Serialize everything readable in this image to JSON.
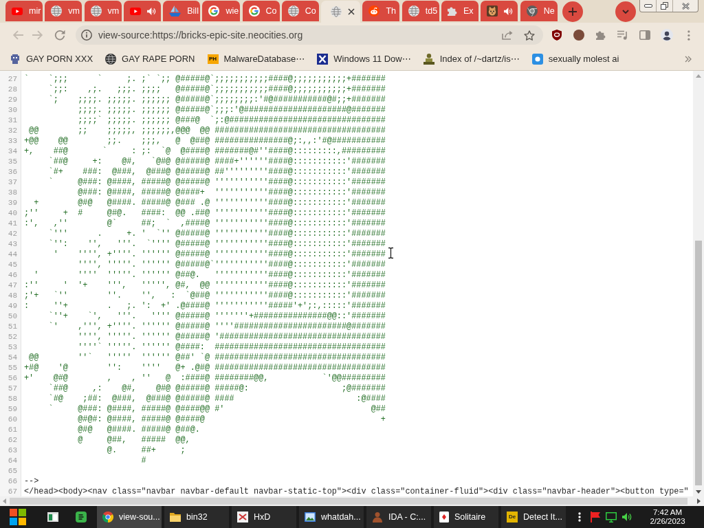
{
  "tabs": [
    {
      "kind": "play",
      "title": "mir",
      "audio": false,
      "selected": false
    },
    {
      "kind": "globe",
      "title": "vm",
      "audio": false,
      "selected": false
    },
    {
      "kind": "globe",
      "title": "vm",
      "audio": false,
      "selected": false
    },
    {
      "kind": "play",
      "audio": true,
      "selected": false
    },
    {
      "kind": "boat",
      "title": "Bill",
      "audio": false,
      "selected": false
    },
    {
      "kind": "gletter",
      "title": "wie",
      "audio": false,
      "selected": false
    },
    {
      "kind": "gletter",
      "title": "Co",
      "audio": false,
      "selected": false
    },
    {
      "kind": "globe",
      "title": "Co",
      "audio": false,
      "selected": false
    },
    {
      "kind": "globe",
      "audio": false,
      "selected": true
    },
    {
      "kind": "alien",
      "title": "Th",
      "audio": false,
      "selected": false
    },
    {
      "kind": "globe",
      "title": "td5",
      "audio": false,
      "selected": false
    },
    {
      "kind": "puzzle",
      "title": "Ex",
      "audio": false,
      "selected": false
    },
    {
      "kind": "animal",
      "audio": true,
      "selected": false
    },
    {
      "kind": "aperture",
      "title": "Ne",
      "audio": false,
      "selected": false
    }
  ],
  "toolbar": {
    "back": {
      "disabled": true
    },
    "forward": {
      "disabled": true
    },
    "address": "view-source:https://bricks-epic-site.neocities.org"
  },
  "bookmarks": [
    {
      "kind": "pixel",
      "title": "GAY PORN XXX"
    },
    {
      "kind": "globe",
      "title": "GAY RAPE PORN"
    },
    {
      "kind": "letters",
      "logo": "PH",
      "title": "MalwareDatabase⋯"
    },
    {
      "kind": "cross",
      "title": "Windows 11 Dow⋯"
    },
    {
      "kind": "person",
      "title": "Index of /~dartz/is⋯"
    },
    {
      "kind": "tile",
      "title": "sexually molest ai"
    }
  ],
  "source": {
    "lines": [
      {
        "number": "27",
        "kind": "comment",
        "text": "`    `;;;      `     ;. ;` `;; @#####@`;;;;;;;;;;;####@;;;;;;;;;;;+#######"
      },
      {
        "number": "28",
        "kind": "comment",
        "text": "     `;;:    ,;.   ;;;. ;;;;   @#####@`;;;;;;;;;;;####@;;;;;;;;;;;+#######"
      },
      {
        "number": "29",
        "kind": "comment",
        "text": "     `;    ;;;;. ;;;;;. ;;;;;; @#####@`;;;;;;;;:'#@###########@#;;+#######"
      },
      {
        "number": "30",
        "kind": "comment",
        "text": "           ;;;;. ;;;;;. ;;;;;; @#####@`;;;:'@#####################@#######"
      },
      {
        "number": "31",
        "kind": "comment",
        "text": "           ;;;;` ;;;;;. ;;;;;; @###@  `;:@################################"
      },
      {
        "number": "32",
        "kind": "comment",
        "text": " @@        ;;    ;;;;;, ;;;;;;,@@@  @@ ###################################"
      },
      {
        "number": "33",
        "kind": "comment",
        "text": "+@@    @@        ;;.    ;;;,   @  @##@ ###############@;:,,:'#@###########"
      },
      {
        "number": "34",
        "kind": "comment",
        "text": "+,    ##@       `     : ;:  `@  @####@ #######@#''####@:::::::::,#########"
      },
      {
        "number": "35",
        "kind": "comment",
        "text": "     `##@     +:    @#,   `@#@ @#####@ ####+''''''####@:::::::::::'#######"
      },
      {
        "number": "36",
        "kind": "comment",
        "text": "     `#+    ###:  @###,  @###@ @#####@ ##'''''''''####@:::::::::::'#######"
      },
      {
        "number": "37",
        "kind": "comment",
        "text": "     `     @###: @####, #####@ @#####@ '''''''''''####@:::::::::::'#######"
      },
      {
        "number": "38",
        "kind": "comment",
        "text": "           @###: @####, #####@ @####+  '''''''''''####@:::::::::::'#######"
      },
      {
        "number": "39",
        "kind": "comment",
        "text": "  +        @#@   @####. #####@ @### .@ '''''''''''####@:::::::::::'#######"
      },
      {
        "number": "40",
        "kind": "comment",
        "text": ";''     +  #     @#@.   ####:  @@ .##@ '''''''''''####@:::::::::::'#######"
      },
      {
        "number": "41",
        "kind": "comment",
        "text": ":',   ,''        @`     ##;  `  ,####@ '''''''''''####@:::::::::::'#######"
      },
      {
        "number": "42",
        "kind": "comment",
        "text": "     `'''      .     +. '  `'' @#####@ '''''''''''####@:::::::::::'#######"
      },
      {
        "number": "43",
        "kind": "comment",
        "text": "     `'':    '',   '''.  `'''' @#####@ '''''''''''####@:::::::::::'#######"
      },
      {
        "number": "44",
        "kind": "comment",
        "text": "      '    '''', +''''. '''''' @#####@ '''''''''''####@:::::::::::'#######"
      },
      {
        "number": "45",
        "kind": "comment",
        "text": "           '''', '''''. '''''' @#####@`'''''''''''####@:::::::::::'#######"
      },
      {
        "number": "46",
        "kind": "comment",
        "text": "  '        ''''  '''''. '''''' @##@.   '''''''''''####@:::::::::::'#######"
      },
      {
        "number": "47",
        "kind": "comment",
        "text": ":''     '  '+    ''',   ''''', @#,  @@ '''''''''''####@:::::::::::'#######"
      },
      {
        "number": "48",
        "kind": "comment",
        "text": ";'+   `''        ''.    '',   :  `@##@ '''''''''''####@:::::::::::'#######"
      },
      {
        "number": "49",
        "kind": "comment",
        "text": ":     ''+        .   ;. ':  +' .@####@ '''''''''''#####'+';:,:::::'#######"
      },
      {
        "number": "50",
        "kind": "comment",
        "text": "     `''+    `',   '''.   '''' @#####@ '''''''+###############@@::'#######"
      },
      {
        "number": "51",
        "kind": "comment",
        "text": "     `'    ,''', +''''. '''''' @#####@ ''''#######################@#######"
      },
      {
        "number": "52",
        "kind": "comment",
        "text": "           '''', '''''. '''''' @#####@ '##################################"
      },
      {
        "number": "53",
        "kind": "comment",
        "text": "           ''''` '''''. '''''' @####:  ###################################"
      },
      {
        "number": "54",
        "kind": "comment",
        "text": " @@        ''`   '''''  '''''' @##' `@ ###################################"
      },
      {
        "number": "55",
        "kind": "comment",
        "text": "+#@    '@        '':    ''''   @+ .@#@ ###################################"
      },
      {
        "number": "56",
        "kind": "comment",
        "text": "+'    @#@        ,    , ''   @  :####@ ########@@,           `'@@#########"
      },
      {
        "number": "57",
        "kind": "comment",
        "text": "     `##@     ,:    @#,    @#@ @#####@ #####@:                   ;@#######"
      },
      {
        "number": "58",
        "kind": "comment",
        "text": "     `#@    ;##:  @###,  @###@ @#####@ ####                         :@####"
      },
      {
        "number": "59",
        "kind": "comment",
        "text": "     `     @###: @####, #####@ @####@@ #'                              @##"
      },
      {
        "number": "60",
        "kind": "comment",
        "text": "           @#@#: @####, #####@ @####@                                    +"
      },
      {
        "number": "61",
        "kind": "comment",
        "text": "           @#@   @####. #####@ @##@."
      },
      {
        "number": "62",
        "kind": "comment",
        "text": "           @     @##,   #####  @@,"
      },
      {
        "number": "63",
        "kind": "comment",
        "text": "                 @.     ##+     ;"
      },
      {
        "number": "64",
        "kind": "comment",
        "text": "                        #"
      },
      {
        "number": "65"
      },
      {
        "number": "66",
        "kind": "markup",
        "text": "-->"
      },
      {
        "number": "67",
        "kind": "markup",
        "text": "</head><body><nav class=\"navbar navbar-default navbar-static-top\"><div class=\"container-fluid\"><div class=\"navbar-header\"><button type=\""
      }
    ]
  },
  "taskbar": {
    "windows": [
      {
        "kind": "round",
        "label": "view-sou...",
        "selected": true
      },
      {
        "kind": "folder",
        "label": "bin32",
        "selected": false
      },
      {
        "kind": "hex",
        "label": "HxD",
        "selected": false
      },
      {
        "kind": "picture",
        "label": "whatdah...",
        "selected": false
      },
      {
        "kind": "figure",
        "label": "IDA - C:...",
        "selected": false
      },
      {
        "kind": "card",
        "label": "Solitaire",
        "selected": false
      },
      {
        "kind": "letters",
        "logo": "De",
        "label": "Detect It...",
        "selected": false
      }
    ],
    "clock": {
      "time": "7:42 AM",
      "date": "2/26/2023"
    }
  }
}
